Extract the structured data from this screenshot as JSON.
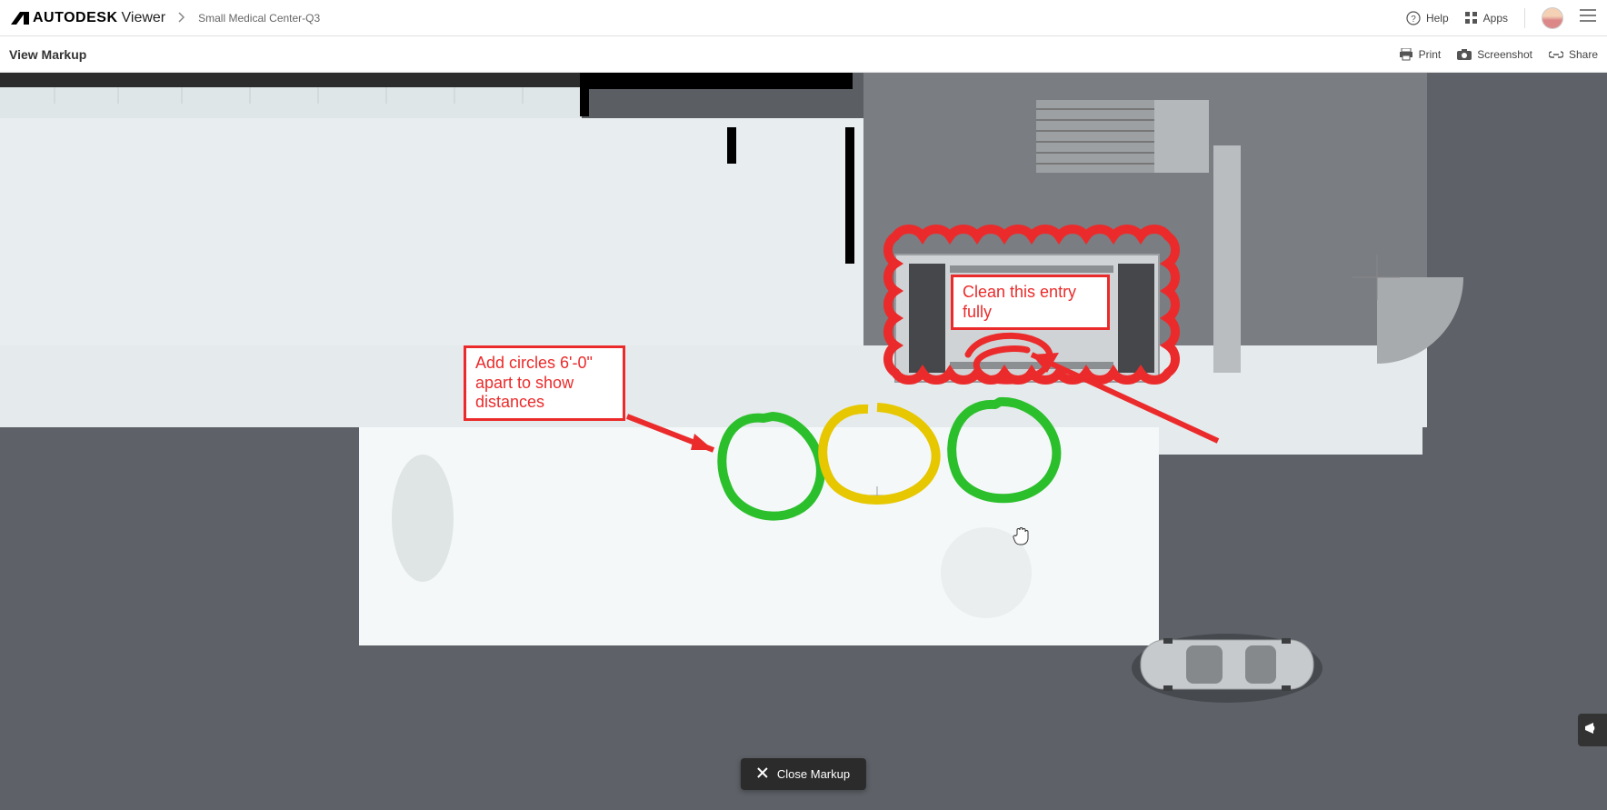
{
  "header": {
    "brand_strong": "AUTODESK",
    "brand_light": "Viewer",
    "breadcrumb_file": "Small Medical Center-Q3",
    "help_label": "Help",
    "apps_label": "Apps"
  },
  "subheader": {
    "title": "View Markup",
    "print_label": "Print",
    "screenshot_label": "Screenshot",
    "share_label": "Share"
  },
  "markups": {
    "circles_note": "Add circles 6'-0\" apart to show distances",
    "entry_note": "Clean this entry fully"
  },
  "footer": {
    "close_label": "Close Markup"
  },
  "colors": {
    "markup_red": "#eb2b2b",
    "markup_green": "#2cbf2c",
    "markup_yellow": "#e6c700",
    "canvas_dark": "#5e6268",
    "canvas_light": "#e8eef0"
  }
}
